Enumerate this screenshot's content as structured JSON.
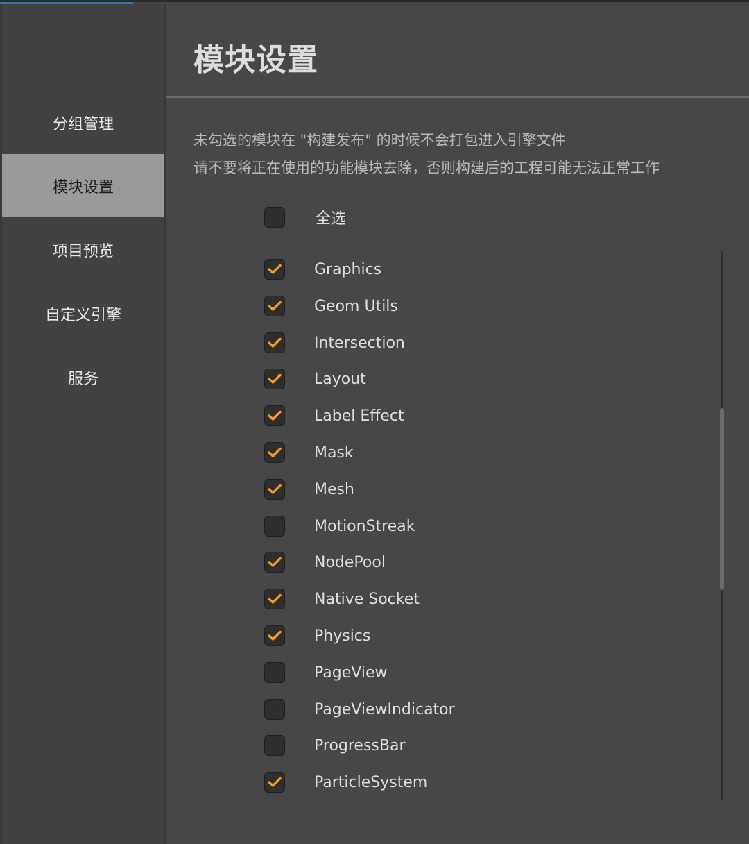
{
  "sidebar": {
    "items": [
      {
        "label": "分组管理",
        "active": false
      },
      {
        "label": "模块设置",
        "active": true
      },
      {
        "label": "项目预览",
        "active": false
      },
      {
        "label": "自定义引擎",
        "active": false
      },
      {
        "label": "服务",
        "active": false
      }
    ]
  },
  "main": {
    "title": "模块设置",
    "description_line1": "未勾选的模块在 \"构建发布\" 的时候不会打包进入引擎文件",
    "description_line2": "请不要将正在使用的功能模块去除，否则构建后的工程可能无法正常工作",
    "select_all": {
      "label": "全选",
      "checked": false
    },
    "modules": [
      {
        "label": "Graphics",
        "checked": true
      },
      {
        "label": "Geom Utils",
        "checked": true
      },
      {
        "label": "Intersection",
        "checked": true
      },
      {
        "label": "Layout",
        "checked": true
      },
      {
        "label": "Label Effect",
        "checked": true
      },
      {
        "label": "Mask",
        "checked": true
      },
      {
        "label": "Mesh",
        "checked": true
      },
      {
        "label": "MotionStreak",
        "checked": false
      },
      {
        "label": "NodePool",
        "checked": true
      },
      {
        "label": "Native Socket",
        "checked": true
      },
      {
        "label": "Physics",
        "checked": true
      },
      {
        "label": "PageView",
        "checked": false
      },
      {
        "label": "PageViewIndicator",
        "checked": false
      },
      {
        "label": "ProgressBar",
        "checked": false
      },
      {
        "label": "ParticleSystem",
        "checked": true
      }
    ]
  },
  "colors": {
    "accent": "#f59a23",
    "active_nav": "#9a9a9a"
  }
}
